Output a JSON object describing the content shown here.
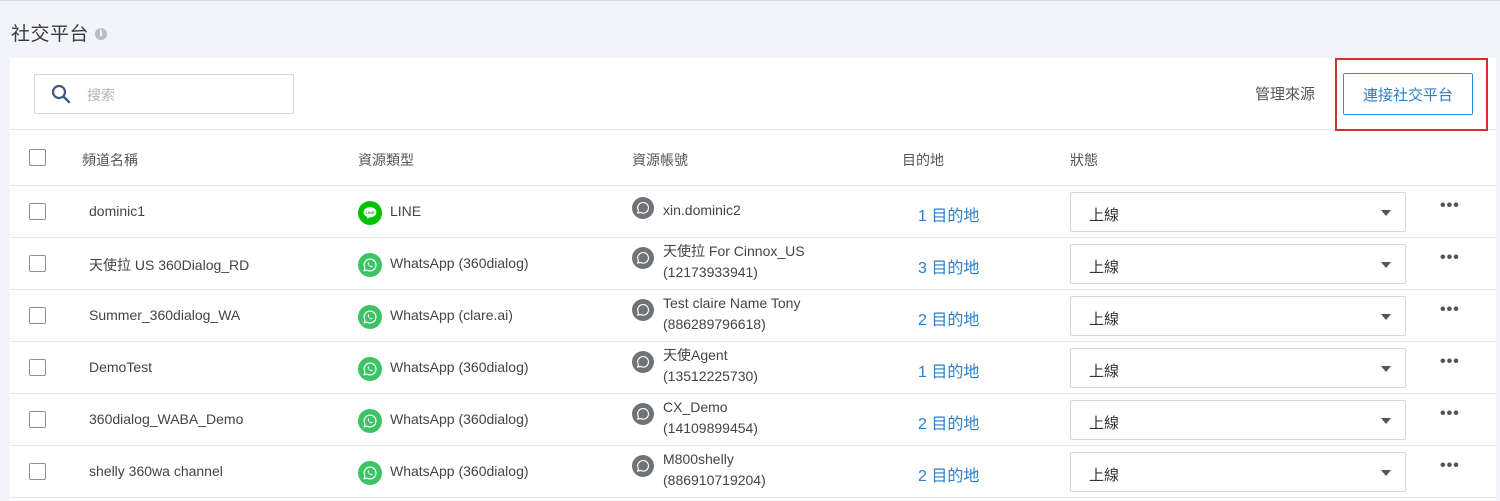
{
  "header": {
    "title": "社交平台"
  },
  "toolbar": {
    "search_placeholder": "搜索",
    "manage_label": "管理來源",
    "connect_label": "連接社交平台"
  },
  "columns": {
    "channel": "頻道名稱",
    "source_type": "資源類型",
    "account": "資源帳號",
    "destination": "目的地",
    "status": "狀態"
  },
  "rows": [
    {
      "channel": "dominic1",
      "source_type": "LINE",
      "source_icon": "line-icon",
      "account_line1": "xin.dominic2",
      "account_line2": "",
      "destination": "1 目的地",
      "status": "上線"
    },
    {
      "channel": "天使拉 US 360Dialog_RD",
      "source_type": "WhatsApp (360dialog)",
      "source_icon": "whatsapp-icon",
      "account_line1": "天使拉 For Cinnox_US",
      "account_line2": "(12173933941)",
      "destination": "3 目的地",
      "status": "上線"
    },
    {
      "channel": "Summer_360dialog_WA",
      "source_type": "WhatsApp (clare.ai)",
      "source_icon": "whatsapp-icon",
      "account_line1": "Test claire Name Tony",
      "account_line2": "(886289796618)",
      "destination": "2 目的地",
      "status": "上線"
    },
    {
      "channel": "DemoTest",
      "source_type": "WhatsApp (360dialog)",
      "source_icon": "whatsapp-icon",
      "account_line1": "天使Agent",
      "account_line2": "(13512225730)",
      "destination": "1 目的地",
      "status": "上線"
    },
    {
      "channel": "360dialog_WABA_Demo",
      "source_type": "WhatsApp (360dialog)",
      "source_icon": "whatsapp-icon",
      "account_line1": "CX_Demo",
      "account_line2": "(14109899454)",
      "destination": "2 目的地",
      "status": "上線"
    },
    {
      "channel": "shelly 360wa channel",
      "source_type": "WhatsApp (360dialog)",
      "source_icon": "whatsapp-icon",
      "account_line1": "M800shelly",
      "account_line2": "(886910719204)",
      "destination": "2 目的地",
      "status": "上線"
    }
  ],
  "colors": {
    "accent": "#2c7fc6",
    "whatsapp": "#3ec266",
    "line": "#00c300",
    "highlight": "#d32f2f"
  }
}
